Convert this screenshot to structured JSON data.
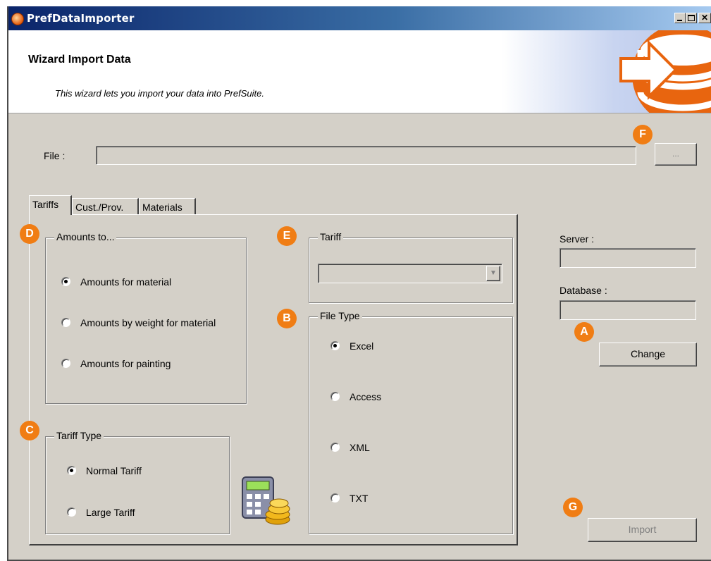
{
  "window": {
    "title": "PrefDataImporter"
  },
  "header": {
    "title": "Wizard Import Data",
    "subtitle": "This wizard lets you import your data into PrefSuite."
  },
  "file": {
    "label": "File :",
    "value": "",
    "browse_label": "..."
  },
  "tabs": [
    {
      "label": "Tariffs",
      "active": true
    },
    {
      "label": "Cust./Prov.",
      "active": false
    },
    {
      "label": "Materials",
      "active": false
    }
  ],
  "amounts_group": {
    "legend": "Amounts to...",
    "options": [
      {
        "label": "Amounts for material",
        "selected": true
      },
      {
        "label": "Amounts by weight for material",
        "selected": false
      },
      {
        "label": "Amounts for painting",
        "selected": false
      }
    ]
  },
  "tariff_type_group": {
    "legend": "Tariff Type",
    "options": [
      {
        "label": "Normal Tariff",
        "selected": true
      },
      {
        "label": "Large Tariff",
        "selected": false
      }
    ]
  },
  "tariff_group": {
    "legend": "Tariff",
    "selected_value": ""
  },
  "file_type_group": {
    "legend": "File Type",
    "options": [
      {
        "label": "Excel",
        "selected": true
      },
      {
        "label": "Access",
        "selected": false
      },
      {
        "label": "XML",
        "selected": false
      },
      {
        "label": "TXT",
        "selected": false
      }
    ]
  },
  "connection": {
    "server_label": "Server :",
    "server_value": "",
    "database_label": "Database :",
    "database_value": "",
    "change_label": "Change"
  },
  "import_label": "Import",
  "badges": {
    "a": "A",
    "b": "B",
    "c": "C",
    "d": "D",
    "e": "E",
    "f": "F",
    "g": "G"
  },
  "colors": {
    "badge": "#f07d14",
    "titlebar": "#0a246a",
    "face": "#d4d0c8"
  }
}
